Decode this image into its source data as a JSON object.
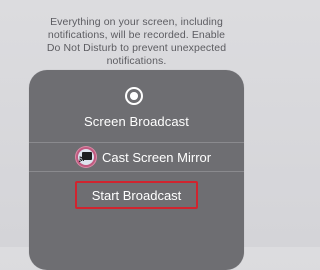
{
  "notice": {
    "text": "Everything on your screen, including notifications, will be recorded. Enable Do Not Disturb to prevent unexpected notifications."
  },
  "sheet": {
    "title": "Screen Broadcast",
    "record_icon": "record-icon",
    "mirror": {
      "label": "Cast Screen Mirror",
      "icon": "screen-mirror-icon"
    },
    "start_button_label": "Start Broadcast"
  },
  "colors": {
    "background": "#d9d9dc",
    "sheet": "#6e6e72",
    "highlight": "#d0242f",
    "mirror_badge": "#c05a80"
  }
}
